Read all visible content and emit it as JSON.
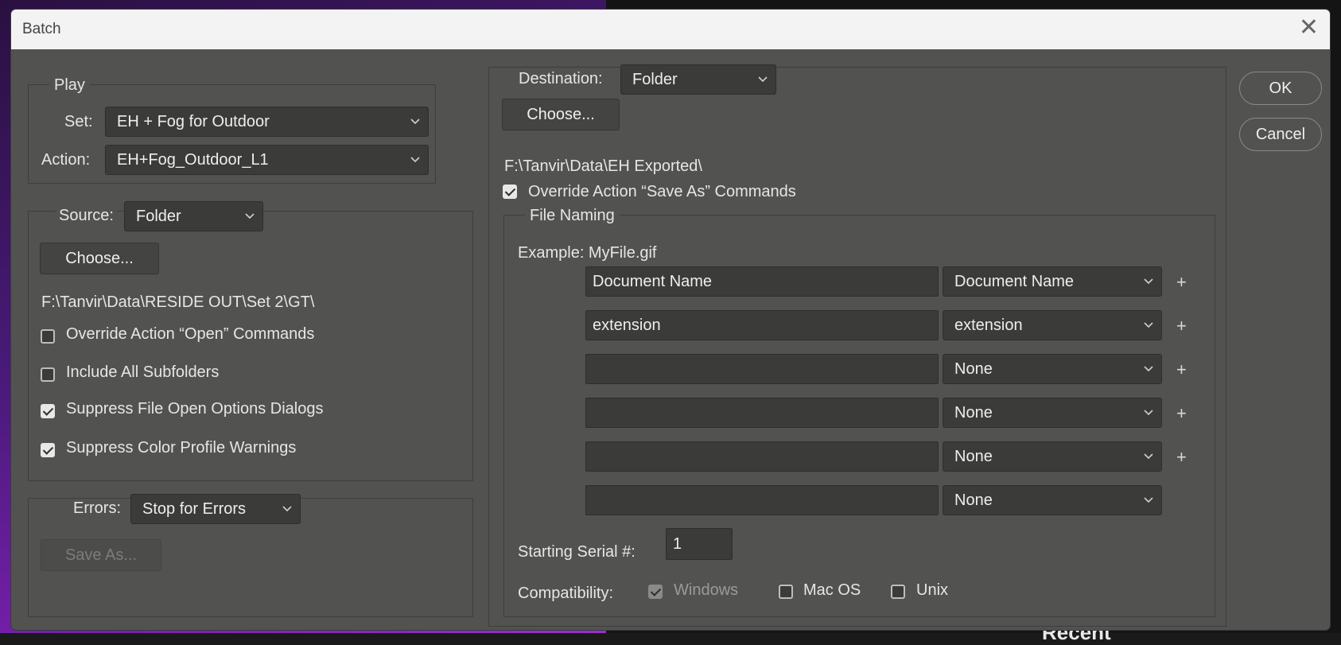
{
  "window": {
    "title": "Batch"
  },
  "play": {
    "legend": "Play",
    "set_label": "Set:",
    "set_value": "EH + Fog for Outdoor",
    "action_label": "Action:",
    "action_value": "EH+Fog_Outdoor_L1"
  },
  "source": {
    "label": "Source:",
    "value": "Folder",
    "choose_label": "Choose...",
    "path": "F:\\Tanvir\\Data\\RESIDE OUT\\Set 2\\GT\\",
    "options": [
      {
        "label": "Override Action “Open” Commands",
        "checked": false
      },
      {
        "label": "Include All Subfolders",
        "checked": false
      },
      {
        "label": "Suppress File Open Options Dialogs",
        "checked": true
      },
      {
        "label": "Suppress Color Profile Warnings",
        "checked": true
      }
    ]
  },
  "errors": {
    "label": "Errors:",
    "value": "Stop for Errors",
    "save_as_label": "Save As..."
  },
  "destination": {
    "label": "Destination:",
    "value": "Folder",
    "choose_label": "Choose...",
    "path": "F:\\Tanvir\\Data\\EH Exported\\",
    "override_label": "Override Action “Save As” Commands",
    "override_checked": true
  },
  "file_naming": {
    "legend": "File Naming",
    "example": "Example: MyFile.gif",
    "rows": [
      {
        "text": "Document Name",
        "select": "Document Name"
      },
      {
        "text": "extension",
        "select": "extension"
      },
      {
        "text": "",
        "select": "None"
      },
      {
        "text": "",
        "select": "None"
      },
      {
        "text": "",
        "select": "None"
      },
      {
        "text": "",
        "select": "None"
      }
    ],
    "plus_symbol": "+",
    "serial_label": "Starting Serial #:",
    "serial_value": "1",
    "compat_label": "Compatibility:",
    "compat": [
      {
        "label": "Windows",
        "checked": true,
        "disabled": true
      },
      {
        "label": "Mac OS",
        "checked": false,
        "disabled": false
      },
      {
        "label": "Unix",
        "checked": false,
        "disabled": false
      }
    ]
  },
  "buttons": {
    "ok": "OK",
    "cancel": "Cancel"
  },
  "background": {
    "text": "Recent"
  },
  "icons": {
    "close": "close-icon",
    "dropdown": "chevron-down-icon",
    "add": "plus-icon"
  }
}
